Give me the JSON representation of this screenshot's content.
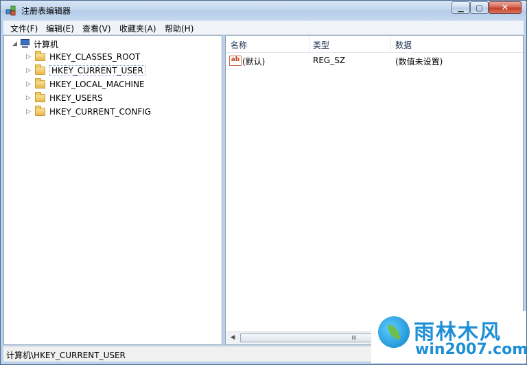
{
  "window": {
    "title": "注册表编辑器",
    "minimize_glyph": "▁",
    "maximize_glyph": "▢",
    "close_glyph": "✕"
  },
  "menu": [
    "文件(F)",
    "编辑(E)",
    "查看(V)",
    "收藏夹(A)",
    "帮助(H)"
  ],
  "tree": {
    "root": "计算机",
    "items": [
      {
        "label": "HKEY_CLASSES_ROOT",
        "selected": false
      },
      {
        "label": "HKEY_CURRENT_USER",
        "selected": true
      },
      {
        "label": "HKEY_LOCAL_MACHINE",
        "selected": false
      },
      {
        "label": "HKEY_USERS",
        "selected": false
      },
      {
        "label": "HKEY_CURRENT_CONFIG",
        "selected": false
      }
    ],
    "expand_glyph": "▷",
    "collapse_glyph": "◢"
  },
  "list": {
    "columns": [
      "名称",
      "类型",
      "数据"
    ],
    "rows": [
      {
        "icon": "string-value-icon",
        "icon_text": "ab",
        "name": "(默认)",
        "type": "REG_SZ",
        "data": "(数值未设置)"
      }
    ]
  },
  "scrollbar": {
    "left": "◀",
    "thumb_grip": "III"
  },
  "statusbar": {
    "path": "计算机\\HKEY_CURRENT_USER"
  },
  "watermark": {
    "cn": "雨林木风",
    "en": "win2007.com"
  },
  "colors": {
    "title_gradient": "#c3d7ee",
    "close_button": "#c23a22",
    "watermark": "#1d8fd6"
  }
}
